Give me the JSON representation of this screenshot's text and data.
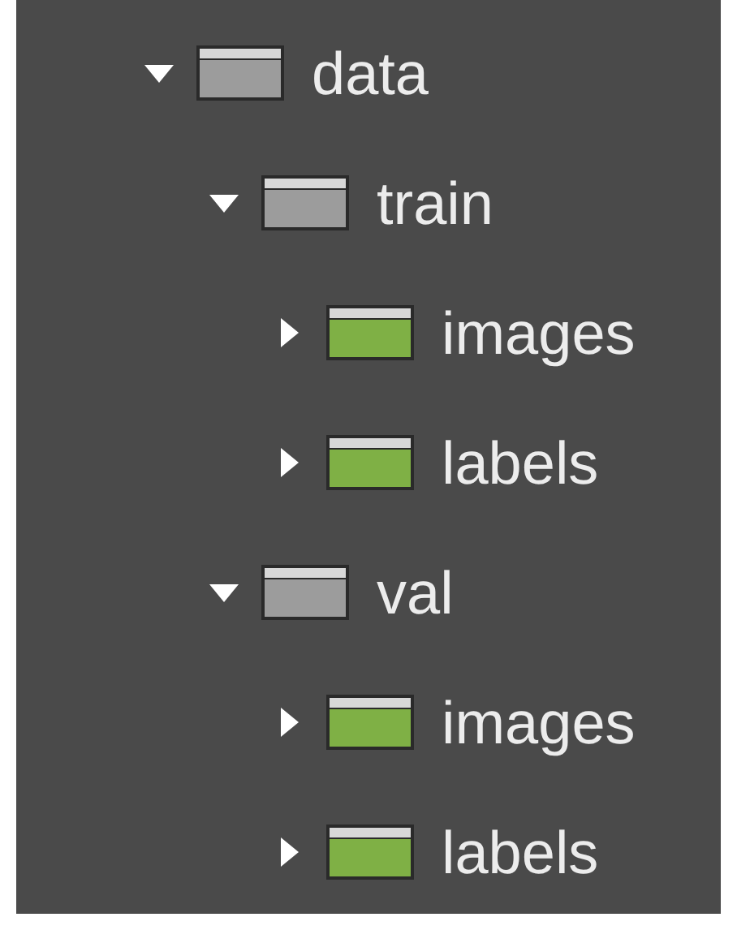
{
  "tree": [
    {
      "label": "data",
      "expanded": true,
      "color": "#9c9c9c",
      "children": [
        {
          "label": "train",
          "expanded": true,
          "color": "#9c9c9c",
          "children": [
            {
              "label": "images",
              "expanded": false,
              "color": "#7fb045"
            },
            {
              "label": "labels",
              "expanded": false,
              "color": "#7fb045"
            }
          ]
        },
        {
          "label": "val",
          "expanded": true,
          "color": "#9c9c9c",
          "children": [
            {
              "label": "images",
              "expanded": false,
              "color": "#7fb045"
            },
            {
              "label": "labels",
              "expanded": false,
              "color": "#7fb045"
            }
          ]
        }
      ]
    }
  ]
}
